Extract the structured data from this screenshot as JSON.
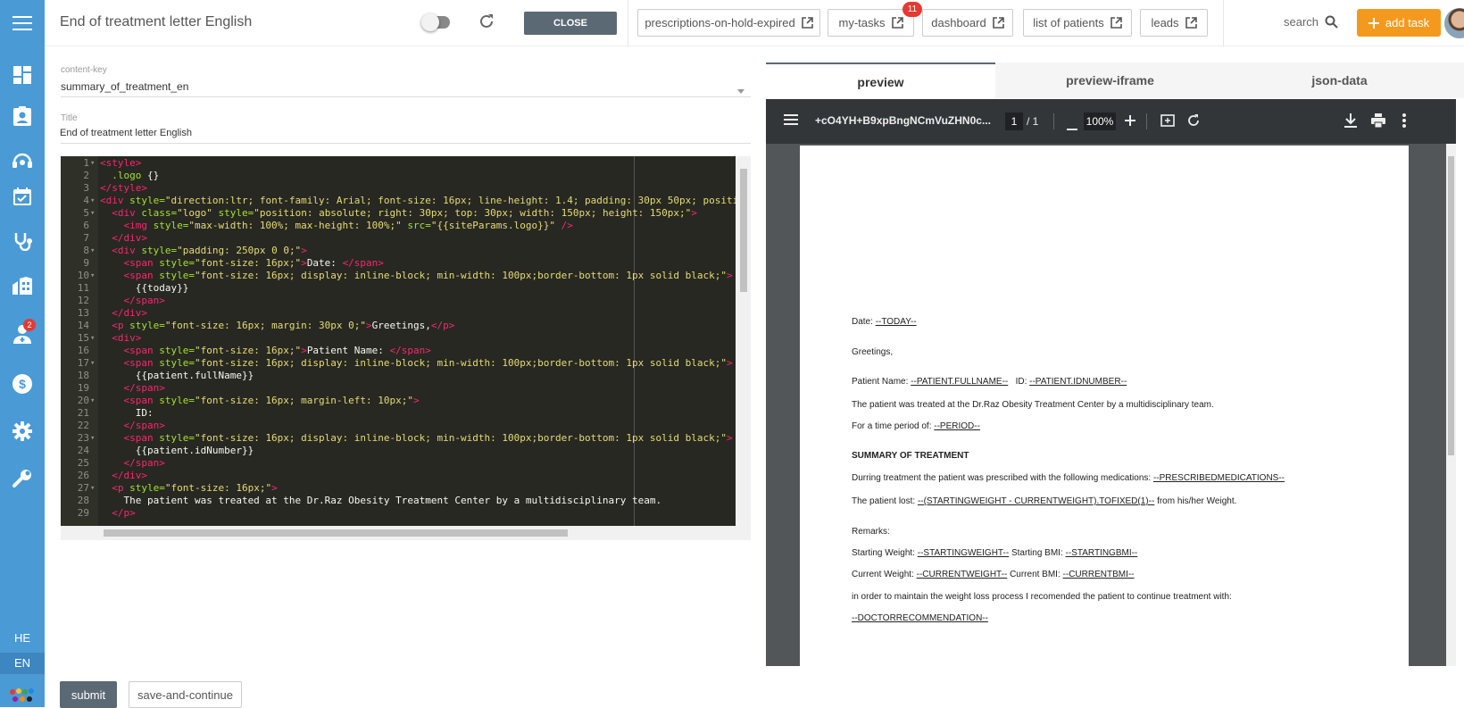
{
  "header": {
    "title": "End of treatment letter English",
    "close_label": "CLOSE",
    "links": [
      "prescriptions-on-hold-expired",
      "my-tasks",
      "dashboard",
      "list of patients",
      "leads"
    ],
    "my_tasks_badge": "11",
    "search_label": "search",
    "add_task_label": "add task"
  },
  "sidebar": {
    "badge": "2",
    "lang_he": "HE",
    "lang_en": "EN"
  },
  "form": {
    "content_key_label": "content-key",
    "content_key_value": "summary_of_treatment_en",
    "title_label": "Title",
    "title_value": "End of treatment letter English",
    "submit_label": "submit",
    "save_continue_label": "save-and-continue"
  },
  "editor": {
    "lines": [
      {
        "n": "1",
        "fold": true,
        "segs": [
          [
            "t",
            "<style>"
          ]
        ]
      },
      {
        "n": "2",
        "fold": false,
        "segs": [
          [
            "a",
            "  .logo"
          ],
          [
            "w",
            " {}"
          ]
        ]
      },
      {
        "n": "3",
        "fold": false,
        "segs": [
          [
            "t",
            "</style>"
          ]
        ]
      },
      {
        "n": "4",
        "fold": true,
        "segs": [
          [
            "t",
            "<div"
          ],
          [
            "a",
            " style="
          ],
          [
            "s",
            "\"direction:ltr; font-family: Arial; font-size: 16px; line-height: 1.4; padding: 30px 50px; positi"
          ]
        ]
      },
      {
        "n": "5",
        "fold": true,
        "segs": [
          [
            "t",
            "  <div"
          ],
          [
            "a",
            " class="
          ],
          [
            "s",
            "\"logo\""
          ],
          [
            "a",
            " style="
          ],
          [
            "s",
            "\"position: absolute; right: 30px; top: 30px; width: 150px; height: 150px;\""
          ],
          [
            "t",
            ">"
          ]
        ]
      },
      {
        "n": "6",
        "fold": false,
        "segs": [
          [
            "t",
            "    <img"
          ],
          [
            "a",
            " style="
          ],
          [
            "s",
            "\"max-width: 100%; max-height: 100%;\""
          ],
          [
            "a",
            " src="
          ],
          [
            "s",
            "\"{{siteParams.logo}}\""
          ],
          [
            "t",
            " />"
          ]
        ]
      },
      {
        "n": "7",
        "fold": false,
        "segs": [
          [
            "t",
            "  </div>"
          ]
        ]
      },
      {
        "n": "8",
        "fold": true,
        "segs": [
          [
            "t",
            "  <div"
          ],
          [
            "a",
            " style="
          ],
          [
            "s",
            "\"padding: 250px 0 0;\""
          ],
          [
            "t",
            ">"
          ]
        ]
      },
      {
        "n": "9",
        "fold": false,
        "segs": [
          [
            "t",
            "    <span"
          ],
          [
            "a",
            " style="
          ],
          [
            "s",
            "\"font-size: 16px;\""
          ],
          [
            "t",
            ">"
          ],
          [
            "w",
            "Date: "
          ],
          [
            "t",
            "</span>"
          ]
        ]
      },
      {
        "n": "10",
        "fold": true,
        "segs": [
          [
            "t",
            "    <span"
          ],
          [
            "a",
            " style="
          ],
          [
            "s",
            "\"font-size: 16px; display: inline-block; min-width: 100px;border-bottom: 1px solid black;\""
          ],
          [
            "t",
            ">"
          ]
        ]
      },
      {
        "n": "11",
        "fold": false,
        "segs": [
          [
            "w",
            "      {{today}}"
          ]
        ]
      },
      {
        "n": "12",
        "fold": false,
        "segs": [
          [
            "t",
            "    </span>"
          ]
        ]
      },
      {
        "n": "13",
        "fold": false,
        "segs": [
          [
            "t",
            "  </div>"
          ]
        ]
      },
      {
        "n": "14",
        "fold": false,
        "segs": [
          [
            "t",
            "  <p"
          ],
          [
            "a",
            " style="
          ],
          [
            "s",
            "\"font-size: 16px; margin: 30px 0;\""
          ],
          [
            "t",
            ">"
          ],
          [
            "w",
            "Greetings,"
          ],
          [
            "t",
            "</p>"
          ]
        ]
      },
      {
        "n": "15",
        "fold": true,
        "segs": [
          [
            "t",
            "  <div>"
          ]
        ]
      },
      {
        "n": "16",
        "fold": false,
        "segs": [
          [
            "t",
            "    <span"
          ],
          [
            "a",
            " style="
          ],
          [
            "s",
            "\"font-size: 16px;\""
          ],
          [
            "t",
            ">"
          ],
          [
            "w",
            "Patient Name: "
          ],
          [
            "t",
            "</span>"
          ]
        ]
      },
      {
        "n": "17",
        "fold": true,
        "segs": [
          [
            "t",
            "    <span"
          ],
          [
            "a",
            " style="
          ],
          [
            "s",
            "\"font-size: 16px; display: inline-block; min-width: 100px;border-bottom: 1px solid black;\""
          ],
          [
            "t",
            ">"
          ]
        ]
      },
      {
        "n": "18",
        "fold": false,
        "segs": [
          [
            "w",
            "      {{patient.fullName}}"
          ]
        ]
      },
      {
        "n": "19",
        "fold": false,
        "segs": [
          [
            "t",
            "    </span>"
          ]
        ]
      },
      {
        "n": "20",
        "fold": true,
        "segs": [
          [
            "t",
            "    <span"
          ],
          [
            "a",
            " style="
          ],
          [
            "s",
            "\"font-size: 16px; margin-left: 10px;\""
          ],
          [
            "t",
            ">"
          ]
        ]
      },
      {
        "n": "21",
        "fold": false,
        "segs": [
          [
            "w",
            "      ID:"
          ]
        ]
      },
      {
        "n": "22",
        "fold": false,
        "segs": [
          [
            "t",
            "    </span>"
          ]
        ]
      },
      {
        "n": "23",
        "fold": true,
        "segs": [
          [
            "t",
            "    <span"
          ],
          [
            "a",
            " style="
          ],
          [
            "s",
            "\"font-size: 16px; display: inline-block; min-width: 100px;border-bottom: 1px solid black;\""
          ],
          [
            "t",
            ">"
          ]
        ]
      },
      {
        "n": "24",
        "fold": false,
        "segs": [
          [
            "w",
            "      {{patient.idNumber}}"
          ]
        ]
      },
      {
        "n": "25",
        "fold": false,
        "segs": [
          [
            "t",
            "    </span>"
          ]
        ]
      },
      {
        "n": "26",
        "fold": false,
        "segs": [
          [
            "t",
            "  </div>"
          ]
        ]
      },
      {
        "n": "27",
        "fold": true,
        "segs": [
          [
            "t",
            "  <p"
          ],
          [
            "a",
            " style="
          ],
          [
            "s",
            "\"font-size: 16px;\""
          ],
          [
            "t",
            ">"
          ]
        ]
      },
      {
        "n": "28",
        "fold": false,
        "segs": [
          [
            "w",
            "    The patient was treated at the Dr.Raz Obesity Treatment Center by a multidisciplinary team."
          ]
        ]
      },
      {
        "n": "29",
        "fold": false,
        "segs": [
          [
            "t",
            "  </p>"
          ]
        ]
      }
    ]
  },
  "tabs": [
    "preview",
    "preview-iframe",
    "json-data"
  ],
  "pdf": {
    "filename": "+cO4YH+B9xpBngNCmVuZHN0c...",
    "page": "1",
    "total": "/  1",
    "zoom": "100%",
    "date_label": "Date:",
    "date_value": "--TODAY--",
    "greetings": "Greetings,",
    "patient_label": "Patient Name:",
    "patient_value": "--PATIENT.FULLNAME--",
    "id_label": "ID:",
    "id_value": "--PATIENT.IDNUMBER--",
    "treated_text": "The patient was treated at the Dr.Raz Obesity Treatment Center by a multidisciplinary team.",
    "period_label": "For a time period of:",
    "period_value": "--PERIOD--",
    "summary_heading": "SUMMARY OF TREATMENT",
    "meds_label": "Durring treatment the patient was prescribed with the following medications:",
    "meds_value": "--PRESCRIBEDMEDICATIONS--",
    "lost_label": "The patient lost:",
    "lost_value": "--(STARTINGWEIGHT - CURRENTWEIGHT).TOFIXED(1)--",
    "lost_suffix": "from his/her Weight.",
    "remarks": "Remarks:",
    "sw_label": "Starting Weight:",
    "sw_value": "--STARTINGWEIGHT--",
    "sbmi_label": "Starting BMI:",
    "sbmi_value": "--STARTINGBMI--",
    "cw_label": "Current Weight:",
    "cw_value": "--CURRENTWEIGHT--",
    "cbmi_label": "Current BMI:",
    "cbmi_value": "--CURRENTBMI--",
    "maintain_text": "in order to maintain the weight loss process I recomended the patient to continue treatment with:",
    "doctor_rec": "--DOCTORRECOMMENDATION--"
  }
}
